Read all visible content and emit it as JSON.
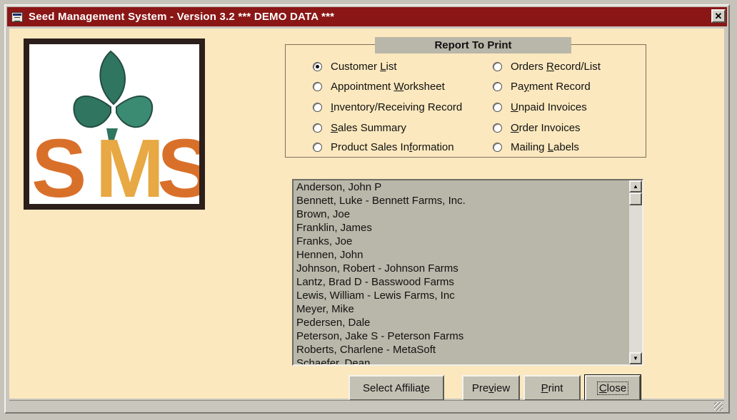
{
  "window": {
    "title": "Seed Management System - Version 3.2 *** DEMO DATA ***"
  },
  "logo": {
    "text": "SMS"
  },
  "report_group": {
    "caption": "Report To Print",
    "options": [
      {
        "pre": "Customer ",
        "key": "L",
        "post": "ist",
        "checked": true
      },
      {
        "pre": "Appointment ",
        "key": "W",
        "post": "orksheet",
        "checked": false
      },
      {
        "pre": "",
        "key": "I",
        "post": "nventory/Receiving Record",
        "checked": false
      },
      {
        "pre": "",
        "key": "S",
        "post": "ales Summary",
        "checked": false
      },
      {
        "pre": "Product Sales In",
        "key": "f",
        "post": "ormation",
        "checked": false
      },
      {
        "pre": "Orders ",
        "key": "R",
        "post": "ecord/List",
        "checked": false
      },
      {
        "pre": "Pa",
        "key": "y",
        "post": "ment Record",
        "checked": false
      },
      {
        "pre": "",
        "key": "U",
        "post": "npaid Invoices",
        "checked": false
      },
      {
        "pre": "",
        "key": "O",
        "post": "rder Invoices",
        "checked": false
      },
      {
        "pre": "Mailing ",
        "key": "L",
        "post": "abels",
        "checked": false
      }
    ]
  },
  "customer_list": {
    "items": [
      "Anderson, John P",
      "Bennett, Luke  - Bennett Farms, Inc.",
      "Brown, Joe",
      "Franklin, James",
      "Franks, Joe",
      "Hennen, John",
      "Johnson, Robert  - Johnson Farms",
      "Lantz, Brad D - Basswood  Farms",
      "Lewis, William  - Lewis Farms, Inc",
      "Meyer, Mike",
      "Pedersen, Dale",
      "Peterson, Jake S - Peterson Farms",
      "Roberts, Charlene  - MetaSoft",
      "Schaefer, Dean"
    ]
  },
  "buttons": [
    {
      "pre": "Select Affilia",
      "key": "t",
      "post": "e"
    },
    {
      "pre": "Pre",
      "key": "v",
      "post": "iew"
    },
    {
      "pre": "",
      "key": "P",
      "post": "rint"
    },
    {
      "pre": "",
      "key": "C",
      "post": "lose"
    }
  ],
  "colors": {
    "titlebar": "#8a1616",
    "client": "#fbe8be",
    "logo_orange": "#d9702a",
    "logo_gold": "#e8a844",
    "logo_green": "#2f7560"
  }
}
